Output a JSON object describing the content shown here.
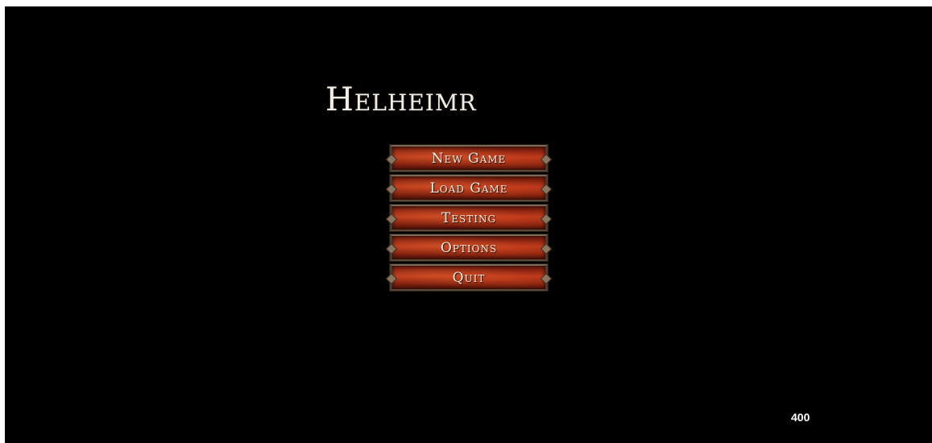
{
  "title": "Helheimr",
  "menu": {
    "items": [
      {
        "label": "New Game"
      },
      {
        "label": "Load Game"
      },
      {
        "label": "Testing"
      },
      {
        "label": "Options"
      },
      {
        "label": "Quit"
      }
    ]
  },
  "counter": "400",
  "colors": {
    "background": "#000000",
    "button_red": "#b4351a",
    "button_frame": "#7a6a58",
    "text": "#f4eee2"
  }
}
